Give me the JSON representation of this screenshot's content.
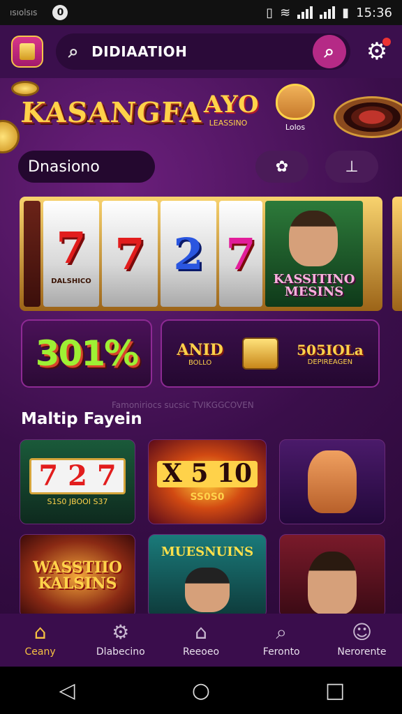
{
  "status": {
    "left_text": "ısıolsıs",
    "time": "15:36"
  },
  "search": {
    "text": "DIDIAATIOH"
  },
  "hero": {
    "brand": "KASANGFA",
    "mini_logo": "AYO",
    "mini_logo_sub": "LEASSINO",
    "mascot_sub": "Lolos"
  },
  "pills": {
    "search_text": "Dnasiono",
    "btn1": "✿",
    "btn2": "⊥"
  },
  "reels": [
    {
      "symbol": "7",
      "color": "#e21d1d",
      "sub": "DALSHICO"
    },
    {
      "symbol": "7",
      "color": "#e21d1d",
      "sub": ""
    },
    {
      "symbol": "2",
      "color": "#2a56e0",
      "sub": ""
    },
    {
      "symbol": "7",
      "color": "#e21d9a",
      "sub": ""
    }
  ],
  "poster": {
    "text": "KASSITINO MESINS"
  },
  "promo": {
    "pct": "301%",
    "emblem": "ANID",
    "emblem_sub": "BOLLO",
    "label": "505IOLa",
    "label_sub": "DEPIREAGEN"
  },
  "section": {
    "subtle": "Famoniriocs sucsic TVIKGGCOVEN",
    "title": "Maltip Fayein"
  },
  "cards": [
    {
      "title": "7 2 7",
      "sub": "S1S0  JBOOI  S37"
    },
    {
      "title": "X 5 10",
      "sub": "SS0S0"
    },
    {
      "title": "",
      "sub": ""
    },
    {
      "title": "WASSTIIO KALSINS",
      "sub": ""
    },
    {
      "title": "MUESNUINS",
      "sub": ""
    },
    {
      "title": "",
      "sub": ""
    }
  ],
  "tabs": [
    {
      "icon": "⌂",
      "label": "Ceany"
    },
    {
      "icon": "⚙",
      "label": "Dlabecino"
    },
    {
      "icon": "⌂",
      "label": "Reeoeo"
    },
    {
      "icon": "⌕",
      "label": "Feronto"
    },
    {
      "icon": "☺",
      "label": "Nerorente"
    }
  ],
  "colors": {
    "accent": "#f6c142",
    "background": "#2a0b36",
    "topbar": "#3b0f4d"
  }
}
